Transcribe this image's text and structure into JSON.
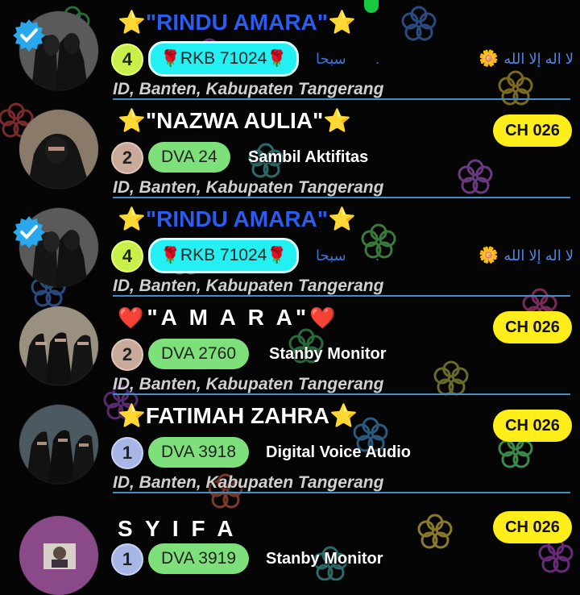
{
  "rows": [
    {
      "name_prefix": "⭐",
      "name": "\"RINDU AMARA\"",
      "name_suffix": "⭐",
      "name_style": "blue",
      "level": "4",
      "level_style": "lvl-4",
      "badge": "RKB 71024",
      "badge_style": "cyan",
      "rose": "🌹",
      "arabic_left": "سبحا",
      "dot": ".",
      "arabic_right": "لا اله إلا الله",
      "flower": "🌼",
      "location": "ID, Banten, Kabupaten Tangerang",
      "verified": true
    },
    {
      "name_prefix": "⭐",
      "name": "\"NAZWA AULIA\"",
      "name_suffix": "⭐",
      "name_style": "white",
      "level": "2",
      "level_style": "lvl-2",
      "badge": "DVA 24",
      "badge_style": "green",
      "status": "Sambil Aktifitas",
      "channel": "CH 026",
      "location": "ID, Banten, Kabupaten Tangerang",
      "verified": false
    },
    {
      "name_prefix": "⭐",
      "name": "\"RINDU AMARA\"",
      "name_suffix": "⭐",
      "name_style": "blue",
      "level": "4",
      "level_style": "lvl-4",
      "badge": "RKB 71024",
      "badge_style": "cyan",
      "rose": "🌹",
      "arabic_left": "سبحا",
      "dot": ".",
      "arabic_right": "لا اله إلا الله",
      "flower": "🌼",
      "location": "ID, Banten, Kabupaten Tangerang",
      "verified": true
    },
    {
      "name_prefix": "❤️",
      "name": "\"A M A R A\"",
      "name_suffix": "❤️",
      "name_style": "white",
      "level": "2",
      "level_style": "lvl-2",
      "badge": "DVA 2760",
      "badge_style": "green",
      "status": "Stanby Monitor",
      "channel": "CH 026",
      "location": "ID, Banten, Kabupaten Tangerang",
      "verified": false
    },
    {
      "name_prefix": "⭐",
      "name": "FATIMAH ZAHRA",
      "name_suffix": "⭐",
      "name_style": "white",
      "level": "1",
      "level_style": "lvl-1",
      "badge": "DVA 3918",
      "badge_style": "green",
      "status": "Digital Voice Audio",
      "channel": "CH 026",
      "location": "ID, Banten, Kabupaten Tangerang",
      "verified": false
    },
    {
      "name_prefix": "",
      "name": "S Y I F A",
      "name_suffix": "",
      "name_style": "white",
      "level": "1",
      "level_style": "lvl-1",
      "badge": "DVA 3919",
      "badge_style": "green",
      "status": "Stanby Monitor",
      "channel": "CH 026",
      "location": "",
      "verified": false
    }
  ],
  "colors": {
    "background": "#050505",
    "channel_badge": "#ffee1a",
    "green_badge": "#7ee07a",
    "cyan_badge": "#22f0f2",
    "divider": "#3f8ec8",
    "verified": "#29a8ee"
  }
}
